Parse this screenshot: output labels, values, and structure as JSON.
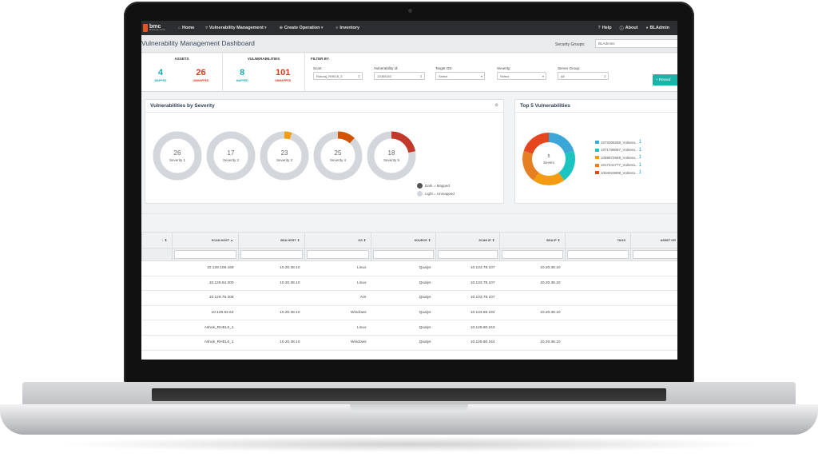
{
  "nav": {
    "logo": "bmc",
    "logo_sub": "BladeLogic Portal",
    "items": [
      {
        "icon": "home-icon",
        "label": "Home"
      },
      {
        "icon": "shield-icon",
        "label": "Vulnerability Management"
      },
      {
        "icon": "plus-circle-icon",
        "label": "Create Operation"
      },
      {
        "icon": "list-icon",
        "label": "Inventory"
      }
    ],
    "right": [
      {
        "icon": "help-icon",
        "label": "Help"
      },
      {
        "icon": "info-icon",
        "label": "About"
      },
      {
        "icon": "user-icon",
        "label": "BLAdmin"
      }
    ]
  },
  "header": {
    "title": "Vulnerability Management Dashboard",
    "security_groups_label": "Security Groups:",
    "security_groups_value": "BLAdmins"
  },
  "stats": {
    "assets": {
      "title": "ASSETS",
      "mapped": "4",
      "mapped_label": "MAPPED",
      "unmapped": "26",
      "unmapped_label": "UNMAPPED"
    },
    "vulnerabilities": {
      "title": "VULNERABILITIES",
      "mapped": "8",
      "mapped_label": "MAPPED",
      "unmapped": "101",
      "unmapped_label": "UNMAPPED"
    }
  },
  "filters": {
    "title": "FILTER BY",
    "scan": {
      "label": "Scan:",
      "value": "Ruturaj_RHEL6_3"
    },
    "vuln_id": {
      "label": "Vulnerability id:",
      "value": "12080183"
    },
    "target_os": {
      "label": "Target OS:",
      "value": "Select"
    },
    "severity": {
      "label": "Severity:",
      "value": "Select"
    },
    "server_group": {
      "label": "Server Group:",
      "value": "All"
    },
    "remediate_button": "+ Remed"
  },
  "severity_panel": {
    "title": "Vulnerabilities by Severity",
    "donuts": [
      {
        "count": "26",
        "label": "Severity 1",
        "mapped_fraction": 0.0
      },
      {
        "count": "17",
        "label": "Severity 2",
        "mapped_fraction": 0.0
      },
      {
        "count": "23",
        "label": "Severity 3",
        "mapped_fraction": 0.05
      },
      {
        "count": "25",
        "label": "Severity 4",
        "mapped_fraction": 0.12
      },
      {
        "count": "18",
        "label": "Severity 5",
        "mapped_fraction": 0.22
      }
    ],
    "key_dark": "Dark = Mapped",
    "key_light": "Light = Unmapped",
    "colors": {
      "light": "#d3d7dc",
      "sev3": "#f39c12",
      "sev4": "#d35400",
      "sev5": "#c0392b"
    }
  },
  "top5_panel": {
    "title": "Top 5 Vulnerabilities",
    "center_count": "5",
    "center_label": "Severs",
    "items": [
      {
        "name": "1072006258_Vulnera...",
        "value": "1",
        "color": "#3aa7d8"
      },
      {
        "name": "1071789067_Vulnera...",
        "value": "1",
        "color": "#1cc4c0"
      },
      {
        "name": "1059872948_Vulnera...",
        "value": "1",
        "color": "#f39c12"
      },
      {
        "name": "1017241777_Vulnera...",
        "value": "1",
        "color": "#e67e22"
      },
      {
        "name": "1004023808_Vulnera...",
        "value": "1",
        "color": "#e5461f"
      }
    ]
  },
  "table": {
    "columns": [
      "",
      "SCAN HOST",
      "BSA HOST",
      "OS",
      "SOURCE",
      "SCAN IP",
      "BSA IP",
      "TAGS",
      "ASSET GR"
    ],
    "sort_marks": [
      "↑ ⇕",
      "▲",
      "⇕",
      "⇕",
      "⇕",
      "⇕",
      "⇕",
      "",
      ""
    ],
    "rows": [
      [
        "",
        "10.129.108.169",
        "10.20.38.10",
        "Linux",
        "Qualys",
        "10.133.78.107",
        "10.20.38.10",
        "",
        ""
      ],
      [
        "",
        "10.129.54.200",
        "10.20.38.10",
        "Linux",
        "Qualys",
        "10.133.78.107",
        "10.20.38.10",
        "",
        ""
      ],
      [
        "",
        "10.129.76.206",
        "",
        "AIX",
        "Qualys",
        "10.133.78.107",
        "",
        "",
        ""
      ],
      [
        "",
        "10.129.92.64",
        "10.20.38.10",
        "Windows",
        "Qualys",
        "10.133.66.194",
        "10.20.38.10",
        "",
        ""
      ],
      [
        "",
        "Ashok_RHEL6_1",
        "",
        "Linux",
        "Qualys",
        "10.129.80.243",
        "",
        "",
        ""
      ],
      [
        "",
        "Ashok_RHEL6_1",
        "10.20.38.10",
        "Windows",
        "Qualys",
        "10.129.80.244",
        "10.20.38.10",
        "",
        ""
      ]
    ]
  }
}
